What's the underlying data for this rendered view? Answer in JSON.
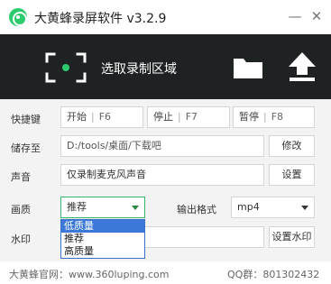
{
  "app": {
    "title": "大黄蜂录屏软件 v3.2.9",
    "minimize": "—",
    "close": "✕"
  },
  "toolbar": {
    "region_label": "选取录制区域",
    "icons": [
      "record-region-icon",
      "folder-icon",
      "upload-icon"
    ]
  },
  "hotkeys": {
    "label": "快捷键",
    "items": [
      {
        "name": "开始",
        "key": "F6"
      },
      {
        "name": "停止",
        "key": "F7"
      },
      {
        "name": "暂停",
        "key": "F8"
      }
    ]
  },
  "save": {
    "label": "储存至",
    "path": "D:/tools/桌面/下载吧",
    "button": "修改"
  },
  "audio": {
    "label": "声音",
    "value": "仅录制麦克风声音",
    "button": "设置"
  },
  "quality": {
    "label": "画质",
    "value": "推荐",
    "options": [
      "低质量",
      "推荐",
      "高质量"
    ]
  },
  "format": {
    "label": "输出格式",
    "value": "mp4"
  },
  "watermark": {
    "label": "水印",
    "button": "设置水印"
  },
  "footer": {
    "site": "大黄蜂官网：www.360luping.com",
    "qq": "QQ群：801302432"
  },
  "colors": {
    "accent": "#2ecb6e",
    "toolbar_bg": "#1f2223",
    "dropdown_highlight": "#3c78d8"
  }
}
